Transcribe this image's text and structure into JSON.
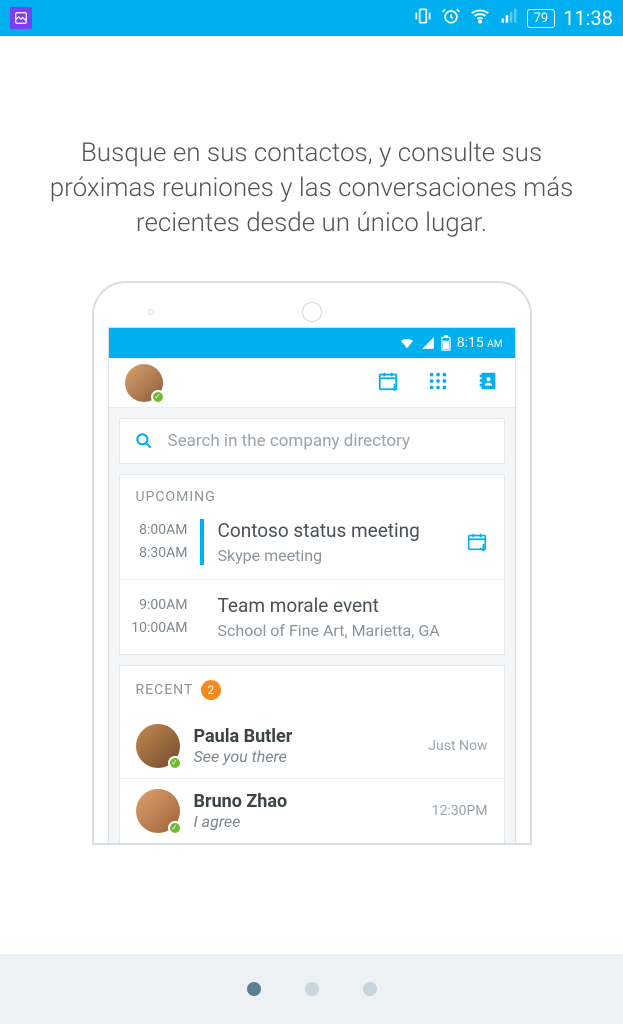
{
  "status_bar": {
    "battery_pct": "79",
    "time": "11:38"
  },
  "onboarding_text": "Busque en sus contactos, y consulte sus próximas reuniones y las conversaciones más recientes desde un único lugar.",
  "mock": {
    "status_time": "8:15",
    "status_time_suffix": "AM",
    "search_placeholder": "Search in the company directory",
    "upcoming_label": "UPCOMING",
    "recent_label": "RECENT",
    "recent_count": "2",
    "meetings": [
      {
        "start": "8:00AM",
        "end": "8:30AM",
        "title": "Contoso status meeting",
        "subtitle": "Skype meeting",
        "is_skype": true
      },
      {
        "start": "9:00AM",
        "end": "10:00AM",
        "title": "Team morale event",
        "subtitle": "School of Fine Art, Marietta, GA",
        "is_skype": false
      }
    ],
    "recent": [
      {
        "name": "Paula Butler",
        "msg": "See you there",
        "time": "Just Now",
        "avatar_css": "linear-gradient(135deg,#c6894f,#6f4b2e)"
      },
      {
        "name": "Bruno Zhao",
        "msg": "I agree",
        "time": "12:30PM",
        "avatar_css": "linear-gradient(135deg,#e0a070,#9a6236)"
      }
    ]
  },
  "pager": {
    "total": 3,
    "active": 0
  },
  "colors": {
    "accent": "#00aff0"
  }
}
